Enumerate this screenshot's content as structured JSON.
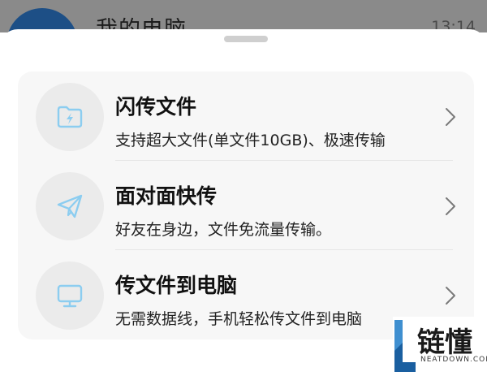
{
  "background": {
    "chat_title": "我的电脑",
    "time": "13:14"
  },
  "sheet": {
    "items": [
      {
        "title": "闪传文件",
        "subtitle": "支持超大文件(单文件10GB)、极速传输",
        "icon": "flash-folder-icon"
      },
      {
        "title": "面对面快传",
        "subtitle": "好友在身边，文件免流量传输。",
        "icon": "paper-plane-icon"
      },
      {
        "title": "传文件到电脑",
        "subtitle": "无需数据线，手机轻松传文件到电脑",
        "icon": "monitor-icon"
      }
    ]
  },
  "watermark": {
    "text": "链懂",
    "sub": "NEATDOWN.COM"
  },
  "colors": {
    "icon_accent": "#8ccdf0",
    "card_bg": "#f7f7f7",
    "icon_circle": "#ebebeb"
  }
}
